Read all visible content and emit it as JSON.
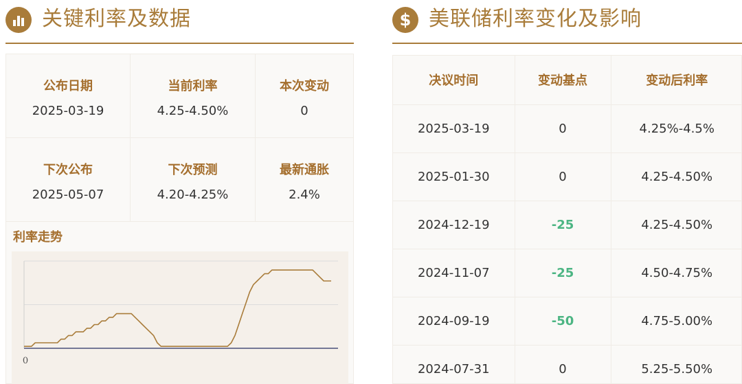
{
  "left": {
    "title": "关键利率及数据",
    "icon": "bar-chart-icon",
    "stats": [
      {
        "label": "公布日期",
        "value": "2025-03-19"
      },
      {
        "label": "当前利率",
        "value": "4.25-4.50%"
      },
      {
        "label": "本次变动",
        "value": "0"
      },
      {
        "label": "下次公布",
        "value": "2025-05-07"
      },
      {
        "label": "下次预测",
        "value": "4.20-4.25%"
      },
      {
        "label": "最新通胀",
        "value": "2.4%"
      }
    ],
    "trend_title": "利率走势"
  },
  "right": {
    "title": "美联储利率变化及影响",
    "icon": "dollar-icon",
    "columns": [
      "决议时间",
      "变动基点",
      "变动后利率"
    ],
    "rows": [
      [
        "2025-03-19",
        "0",
        "4.25%-4.5%"
      ],
      [
        "2025-01-30",
        "0",
        "4.25-4.50%"
      ],
      [
        "2024-12-19",
        "-25",
        "4.25-4.50%"
      ],
      [
        "2024-11-07",
        "-25",
        "4.50-4.75%"
      ],
      [
        "2024-09-19",
        "-50",
        "4.75-5.00%"
      ],
      [
        "2024-07-31",
        "0",
        "5.25-5.50%"
      ]
    ]
  },
  "colors": {
    "accent": "#a97c3a",
    "label": "#a56f2e",
    "negative": "#4cb583"
  },
  "chart_data": {
    "type": "line",
    "title": "",
    "xlabel": "",
    "ylabel": "",
    "y_tick_labels": [
      "0"
    ],
    "ylim": [
      0,
      6
    ],
    "grid": true,
    "series": [
      {
        "values": [
          0.13,
          0.13,
          0.13,
          0.38,
          0.38,
          0.38,
          0.38,
          0.38,
          0.38,
          0.38,
          0.63,
          0.63,
          0.88,
          0.88,
          1.13,
          1.13,
          1.13,
          1.38,
          1.38,
          1.63,
          1.63,
          1.88,
          1.88,
          2.13,
          2.13,
          2.38,
          2.38,
          2.38,
          2.38,
          2.38,
          2.13,
          1.88,
          1.63,
          1.38,
          1.13,
          0.88,
          0.38,
          0.13,
          0.13,
          0.13,
          0.13,
          0.13,
          0.13,
          0.13,
          0.13,
          0.13,
          0.13,
          0.13,
          0.13,
          0.13,
          0.13,
          0.13,
          0.13,
          0.13,
          0.13,
          0.13,
          0.38,
          0.88,
          1.63,
          2.38,
          3.13,
          3.88,
          4.38,
          4.63,
          4.88,
          5.13,
          5.13,
          5.38,
          5.38,
          5.38,
          5.38,
          5.38,
          5.38,
          5.38,
          5.38,
          5.38,
          5.38,
          5.38,
          5.38,
          5.13,
          4.88,
          4.63,
          4.63,
          4.63
        ]
      }
    ]
  }
}
